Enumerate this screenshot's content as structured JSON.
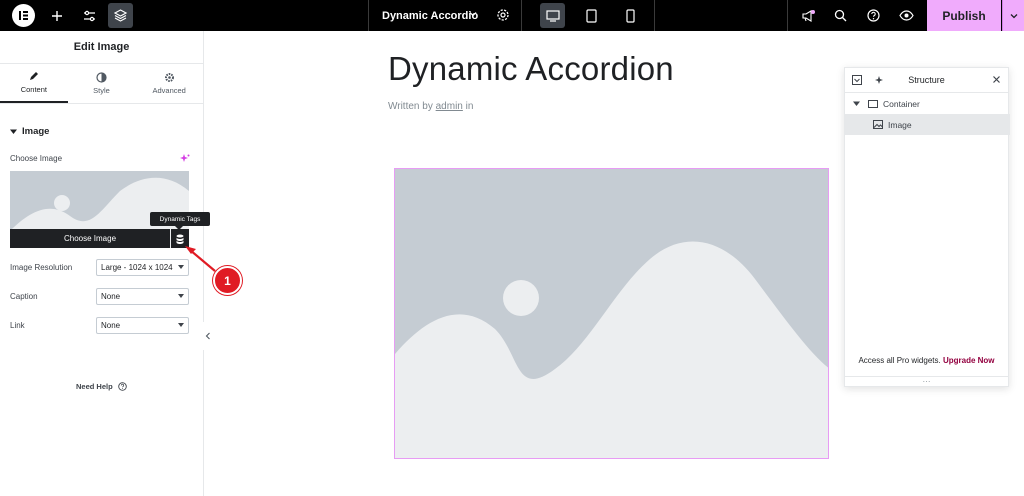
{
  "topbar": {
    "document_title": "Dynamic Accordio",
    "publish_label": "Publish"
  },
  "panel": {
    "title": "Edit Image",
    "tabs": [
      {
        "label": "Content",
        "active": true
      },
      {
        "label": "Style",
        "active": false
      },
      {
        "label": "Advanced",
        "active": false
      }
    ],
    "section_title": "Image",
    "choose_image_label": "Choose Image",
    "choose_image_button": "Choose Image",
    "dynamic_tags_tooltip": "Dynamic Tags",
    "fields": {
      "resolution": {
        "label": "Image Resolution",
        "value": "Large - 1024 x 1024"
      },
      "caption": {
        "label": "Caption",
        "value": "None"
      },
      "link": {
        "label": "Link",
        "value": "None"
      }
    },
    "need_help": "Need Help"
  },
  "annotation": {
    "step": "1"
  },
  "canvas": {
    "heading": "Dynamic Accordion",
    "byline_prefix": "Written by",
    "byline_author": "admin",
    "byline_suffix": "in"
  },
  "structure": {
    "title": "Structure",
    "items": [
      {
        "label": "Container"
      },
      {
        "label": "Image"
      }
    ],
    "promo_text": "Access all Pro widgets.",
    "promo_link": "Upgrade Now"
  },
  "colors": {
    "accent": "#f0abfc",
    "annotation": "#e01b24",
    "upgrade": "#93003f",
    "placeholder": "#c5ccd3"
  }
}
